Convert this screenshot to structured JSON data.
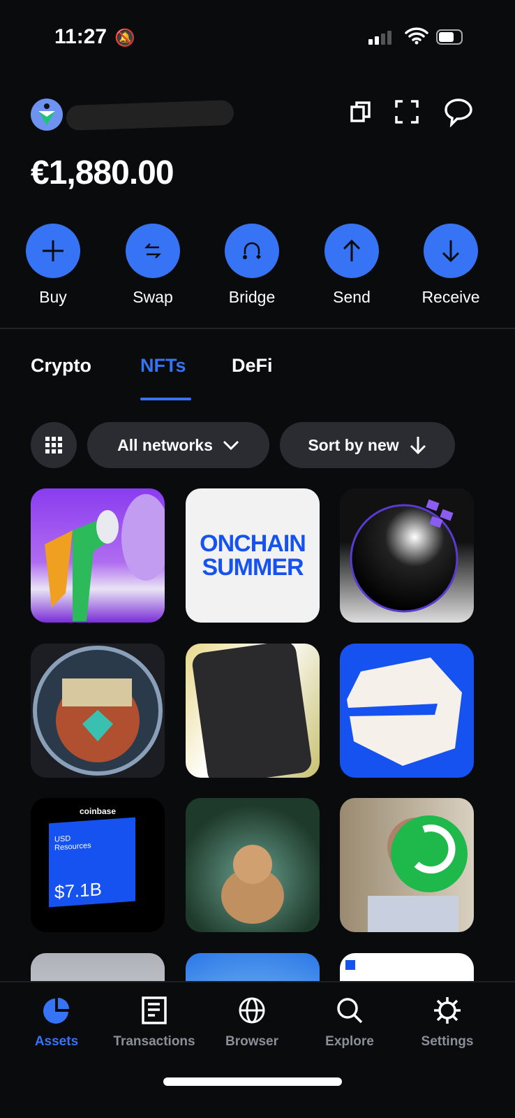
{
  "status": {
    "time": "11:27"
  },
  "wallet": {
    "balance": "€1,880.00"
  },
  "actions": [
    {
      "label": "Buy",
      "icon": "plus-icon"
    },
    {
      "label": "Swap",
      "icon": "swap-icon"
    },
    {
      "label": "Bridge",
      "icon": "bridge-icon"
    },
    {
      "label": "Send",
      "icon": "arrow-up-icon"
    },
    {
      "label": "Receive",
      "icon": "arrow-down-icon"
    }
  ],
  "tabs": [
    {
      "label": "Crypto"
    },
    {
      "label": "NFTs",
      "active": true
    },
    {
      "label": "DeFi"
    }
  ],
  "filters": {
    "networks": "All networks",
    "sort": "Sort by new"
  },
  "nfts": {
    "onchain": "ONCHAIN SUMMER",
    "coinbase": "coinbase",
    "usd": "USD Resources",
    "usd_value": "$7.1B"
  },
  "nav": [
    {
      "label": "Assets",
      "active": true
    },
    {
      "label": "Transactions"
    },
    {
      "label": "Browser"
    },
    {
      "label": "Explore"
    },
    {
      "label": "Settings"
    }
  ],
  "colors": {
    "accent": "#3773f5",
    "background": "#0a0b0d",
    "pill": "#2a2c32",
    "inactive": "#8a8f98"
  }
}
